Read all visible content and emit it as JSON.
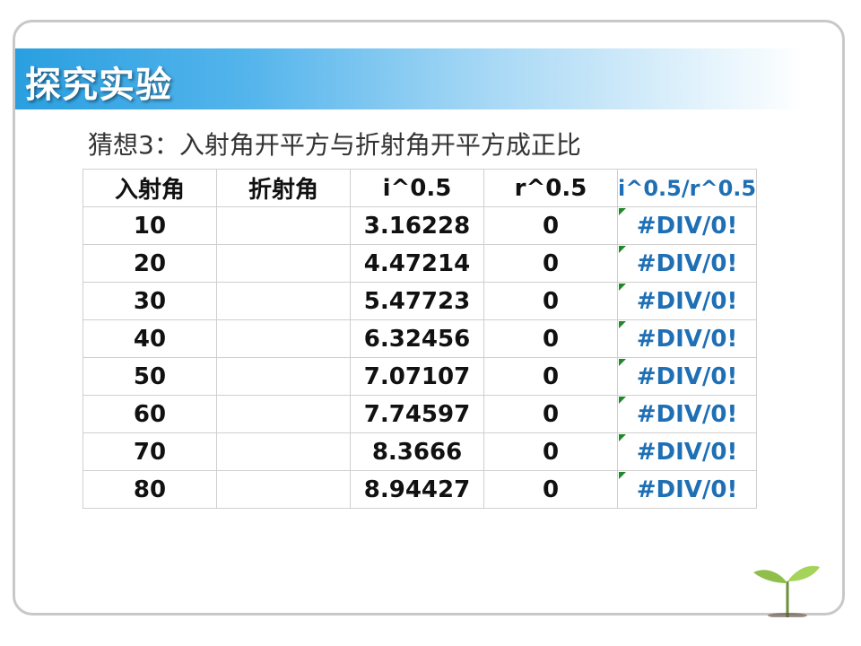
{
  "title": "探究实验",
  "subtitle": "猜想3：入射角开平方与折射角开平方成正比",
  "table": {
    "headers": [
      "入射角",
      "折射角",
      "i^0.5",
      "r^0.5",
      "i^0.5/r^0.5"
    ],
    "rows": [
      [
        "10",
        "",
        "3.16228",
        "0",
        "#DIV/0!"
      ],
      [
        "20",
        "",
        "4.47214",
        "0",
        "#DIV/0!"
      ],
      [
        "30",
        "",
        "5.47723",
        "0",
        "#DIV/0!"
      ],
      [
        "40",
        "",
        "6.32456",
        "0",
        "#DIV/0!"
      ],
      [
        "50",
        "",
        "7.07107",
        "0",
        "#DIV/0!"
      ],
      [
        "60",
        "",
        "7.74597",
        "0",
        "#DIV/0!"
      ],
      [
        "70",
        "",
        "8.3666",
        "0",
        "#DIV/0!"
      ],
      [
        "80",
        "",
        "8.94427",
        "0",
        "#DIV/0!"
      ]
    ]
  },
  "colors": {
    "title_bar": "#2a9fe0",
    "ratio_text": "#1f6fb5",
    "error_flag": "#1d8a2a"
  },
  "icons": [
    "sprout-icon"
  ]
}
